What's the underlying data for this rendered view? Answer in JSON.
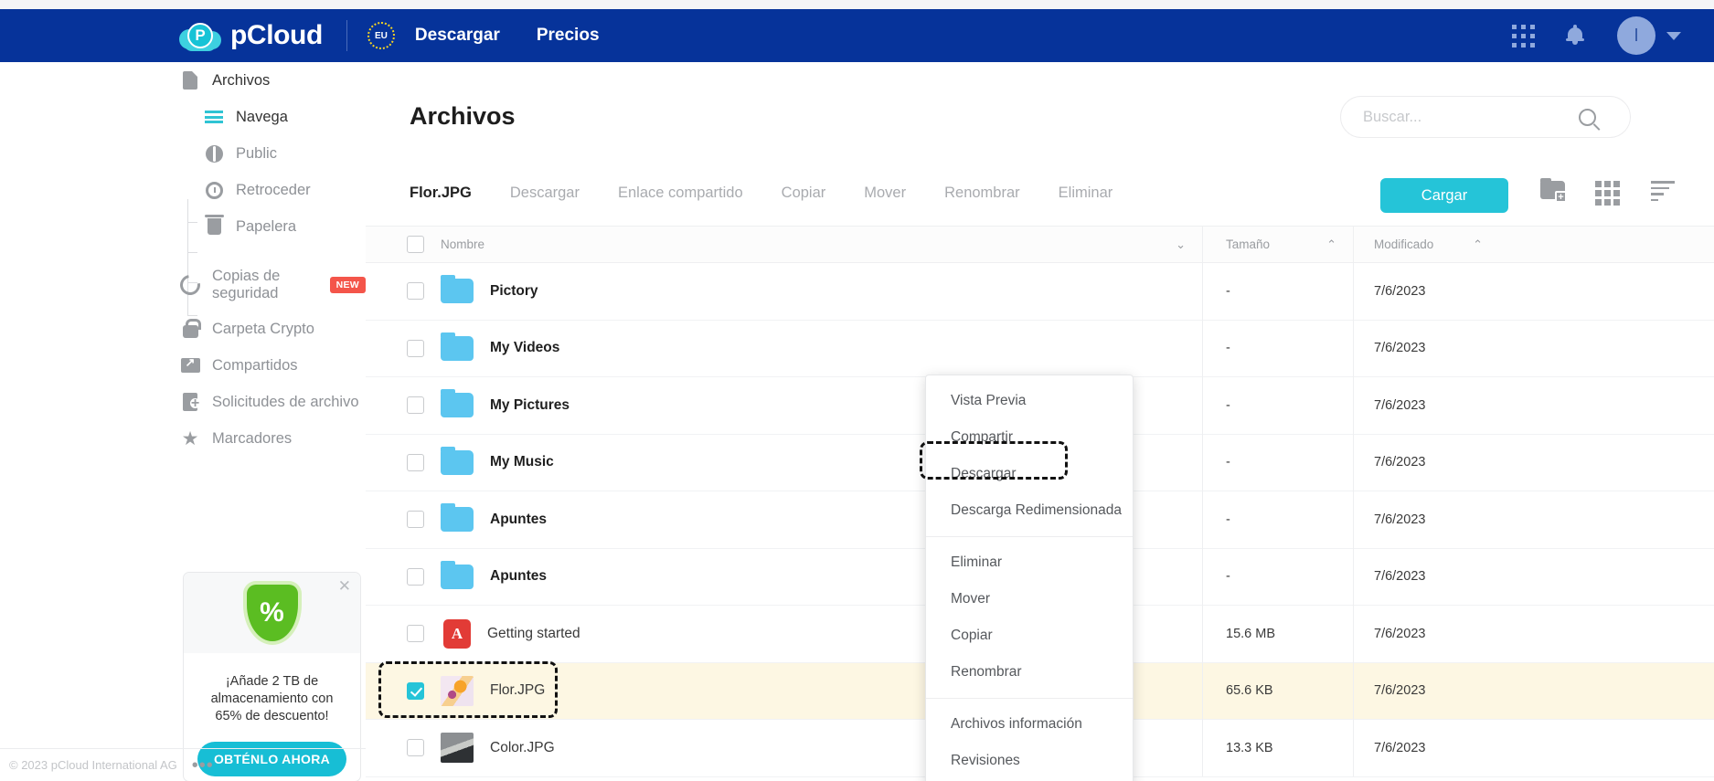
{
  "header": {
    "brand": "pCloud",
    "logo_letter": "P",
    "eu_badge": "EU",
    "links": [
      {
        "label": "Descargar",
        "name": "nav-descargar"
      },
      {
        "label": "Precios",
        "name": "nav-precios"
      }
    ],
    "icons": {
      "apps": "grid-apps-icon",
      "notifications": "bell-icon",
      "avatar": "avatar",
      "avatar_initial": "I",
      "caret": "chevron-down-icon"
    },
    "colors": {
      "bar": "#06339a",
      "accent": "#25c4d8"
    }
  },
  "sidebar": {
    "items": [
      {
        "label": "Archivos",
        "icon": "document-icon",
        "level": 0
      },
      {
        "label": "Navega",
        "icon": "list-icon",
        "level": 1,
        "active": true
      },
      {
        "label": "Public",
        "icon": "globe-icon",
        "level": 1
      },
      {
        "label": "Retroceder",
        "icon": "clock-rewind-icon",
        "level": 1
      },
      {
        "label": "Papelera",
        "icon": "trash-icon",
        "level": 1
      }
    ],
    "items2": [
      {
        "label": "Copias de seguridad",
        "icon": "backup-icon",
        "badge": "NEW"
      },
      {
        "label": "Carpeta Crypto",
        "icon": "lock-icon"
      },
      {
        "label": "Compartidos",
        "icon": "shared-folder-icon"
      },
      {
        "label": "Solicitudes de archivo",
        "icon": "file-request-icon"
      },
      {
        "label": "Marcadores",
        "icon": "star-icon"
      }
    ],
    "promo": {
      "icon": "percent-shield-icon",
      "close": "close-icon",
      "text": "¡Añade 2 TB de almacenamiento con 65% de descuento!",
      "button": "OBTÉNLO AHORA"
    },
    "footer": {
      "copyright": "© 2023 pCloud International AG",
      "more": "more-dots-icon"
    }
  },
  "main": {
    "title": "Archivos",
    "search": {
      "value": "",
      "placeholder": "Buscar...",
      "icon": "search-icon"
    },
    "actionbar": {
      "selected_file": "Flor.JPG",
      "actions": [
        "Descargar",
        "Enlace compartido",
        "Copiar",
        "Mover",
        "Renombrar",
        "Eliminar"
      ],
      "upload_button": "Cargar",
      "tools": [
        "new-folder-icon",
        "grid-view-icon",
        "sort-icon"
      ]
    },
    "table": {
      "headers": {
        "name": "Nombre",
        "size": "Tamaño",
        "modified": "Modificado"
      },
      "sort_icons": {
        "name": "chevron-down-icon",
        "size": "chevron-up-icon",
        "modified": "chevron-up-icon"
      },
      "rows": [
        {
          "name": "Pictory",
          "type": "folder",
          "size": "-",
          "modified": "7/6/2023",
          "checked": false,
          "selected": false
        },
        {
          "name": "My Videos",
          "type": "folder",
          "size": "-",
          "modified": "7/6/2023",
          "checked": false,
          "selected": false
        },
        {
          "name": "My Pictures",
          "type": "folder",
          "size": "-",
          "modified": "7/6/2023",
          "checked": false,
          "selected": false
        },
        {
          "name": "My Music",
          "type": "folder",
          "size": "-",
          "modified": "7/6/2023",
          "checked": false,
          "selected": false
        },
        {
          "name": "Apuntes ",
          "type": "folder",
          "size": "-",
          "modified": "7/6/2023",
          "checked": false,
          "selected": false
        },
        {
          "name": "Apuntes ",
          "type": "folder",
          "size": "-",
          "modified": "7/6/2023",
          "checked": false,
          "selected": false
        },
        {
          "name": "Getting started",
          "type": "pdf",
          "size": "15.6 MB",
          "modified": "7/6/2023",
          "checked": false,
          "selected": false
        },
        {
          "name": "Flor.JPG",
          "type": "image-flower",
          "size": "65.6 KB",
          "modified": "7/6/2023",
          "checked": true,
          "selected": true
        },
        {
          "name": "Color.JPG",
          "type": "image-color",
          "size": "13.3 KB",
          "modified": "7/6/2023",
          "checked": false,
          "selected": false
        }
      ]
    },
    "context_menu": {
      "groups": [
        [
          "Vista Previa",
          "Compartir",
          "Descargar",
          "Descarga Redimensionada"
        ],
        [
          "Eliminar",
          "Mover",
          "Copiar",
          "Renombrar"
        ],
        [
          "Archivos información",
          "Revisiones"
        ]
      ],
      "highlighted": "Descargar"
    }
  }
}
